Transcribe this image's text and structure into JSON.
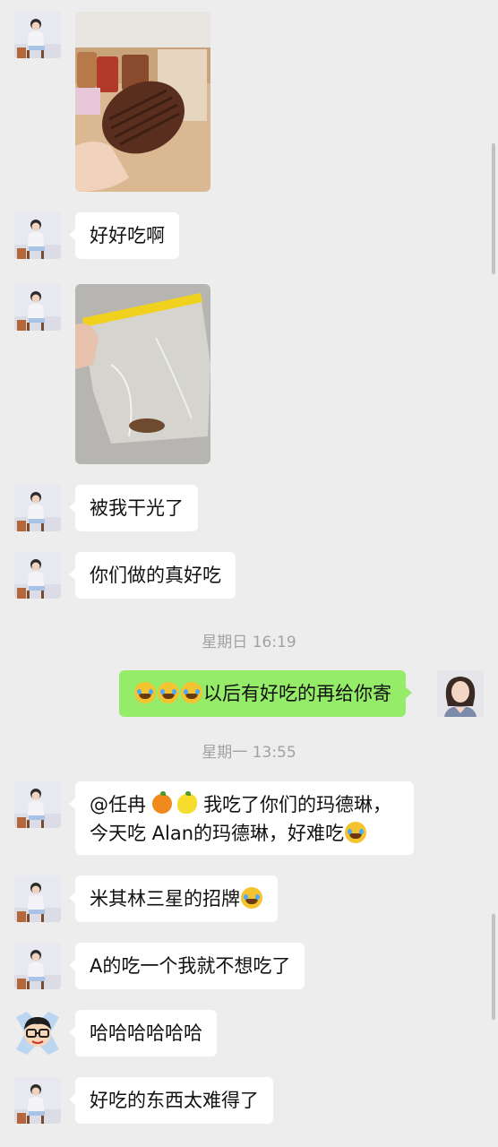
{
  "messages": {
    "m1": {
      "type": "image",
      "image_desc": "madeleine"
    },
    "m2": {
      "text": "好好吃啊"
    },
    "m3": {
      "type": "image",
      "image_desc": "ziploc bag"
    },
    "m4": {
      "text": "被我干光了"
    },
    "m5": {
      "text": "你们做的真好吃"
    },
    "ts1": {
      "text": "星期日 16:19"
    },
    "m6": {
      "text": "以后有好吃的再给你寄"
    },
    "ts2": {
      "text": "星期一 13:55"
    },
    "m7": {
      "line1_prefix": "@任冉",
      "line1_suffix": "我吃了你们的玛德琳，",
      "line2": "今天吃 Alan的玛德琳，好难吃"
    },
    "m8": {
      "text": "米其林三星的招牌"
    },
    "m9": {
      "text": "A的吃一个我就不想吃了"
    },
    "m10": {
      "text": "哈哈哈哈哈哈"
    },
    "m11": {
      "text": "好吃的东西太难得了"
    }
  },
  "colors": {
    "background": "#ededed",
    "bubble_in": "#ffffff",
    "bubble_out": "#95ec69",
    "timestamp": "#a2a2a2"
  },
  "icons": [
    "grin-tears-emoji",
    "tangerine-emoji",
    "lemon-emoji"
  ]
}
